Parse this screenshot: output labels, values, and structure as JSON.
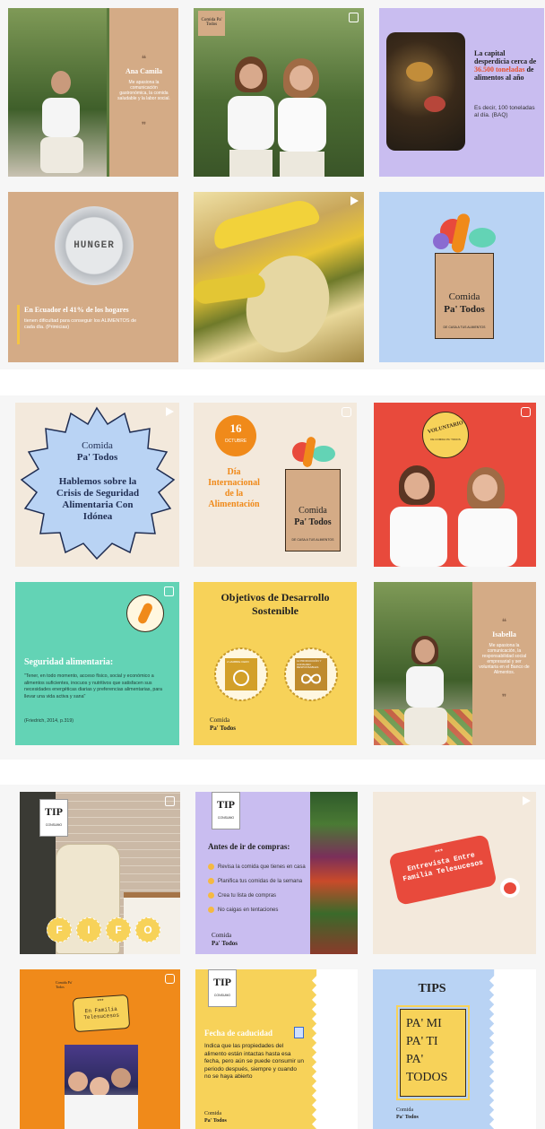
{
  "colors": {
    "tan": "#d4ab86",
    "lavender": "#c9bdf0",
    "blue": "#b9d3f4",
    "cream": "#f3e9dc",
    "red": "#e84a3c",
    "mint": "#63d3b5",
    "yellow": "#f7d259",
    "orange": "#f08a1a",
    "brown": "#8a5a3a"
  },
  "brand": {
    "line1": "Comida",
    "line2": "Pa' Todos",
    "tagline": "DE CASA A TUS ALIMENTOS",
    "small": "Comida Pa' Todos"
  },
  "t1": {
    "quote_mark": "❝❞",
    "name": "Ana Camila",
    "text": "Me apasiona la comunicación gastronómica, la comida saludable y la labor social."
  },
  "t3": {
    "title_a": "La capital desperdicia cerca de ",
    "title_hl": "36.500 toneladas",
    "title_b": " de alimentos al año",
    "sub": "Es decir, 100 toneladas al día. (BAQ)"
  },
  "t4": {
    "plate_text": "HUNGER",
    "headline": "En Ecuador el 41% de los hogares",
    "text": "tienen dificultad para conseguir los ALIMENTOS de cada día. (Primicias)"
  },
  "t7": {
    "title": "Hablemos sobre la Crisis de Seguridad Alimentaria Con Idónea"
  },
  "t8": {
    "day": "16",
    "month": "OCTUBRE",
    "title": "Día Internacional de la Alimentación"
  },
  "t9": {
    "stamp": "VOLUNTARIO",
    "stamp_sub": "DE COMIDA PA' TODOS"
  },
  "t10": {
    "title": "Seguridad alimentaria:",
    "quote": "\"Tener, en todo momento, acceso físico, social y económico a alimentos suficientes, inocuos y nutritivos que satisfacen sus necesidades energéticas diarias y preferencias alimentarias, para llevar una vida activa y sana\"",
    "cite": "(Friedrich, 2014, p.319)"
  },
  "t11": {
    "title": "Objetivos de Desarrollo Sostenible",
    "goal2": "2 HAMBRE CERO",
    "goal12": "12 PRODUCCIÓN Y CONSUMO RESPONSABLES"
  },
  "t12": {
    "name": "Isabella",
    "text": "Me apasiona la comunicación, la responsabilidad social empresarial y ser voluntaria en el Banco de Alimentos."
  },
  "tip": {
    "big": "TIP",
    "small": "CONSUMO"
  },
  "t13": {
    "letters": [
      "F",
      "I",
      "F",
      "O"
    ]
  },
  "t14": {
    "title": "Antes de ir de compras:",
    "items": [
      {
        "n": "1",
        "text": "Revisa la comida que tienes en casa"
      },
      {
        "n": "2",
        "text": "Planifica tus comidas de la semana"
      },
      {
        "n": "3",
        "text": "Crea tu lista de compras"
      },
      {
        "n": "4",
        "text": "No caigas en tentaciones"
      }
    ]
  },
  "t15": {
    "stars": "***",
    "text": "Entrevista Entre Familia Telesucesos"
  },
  "t16": {
    "stars": "***",
    "text": "En Familia Telesucesos"
  },
  "t17": {
    "title": "Fecha de caducidad",
    "text": "Indica que las propiedades del alimento están intactas hasta esa fecha, pero aún se puede consumir un periodo después, siempre y cuando no se haya abierto"
  },
  "t18": {
    "title": "TIPS",
    "l1": "PA' MI",
    "l2": "PA' TI",
    "l3": "PA'",
    "l4": "TODOS"
  }
}
